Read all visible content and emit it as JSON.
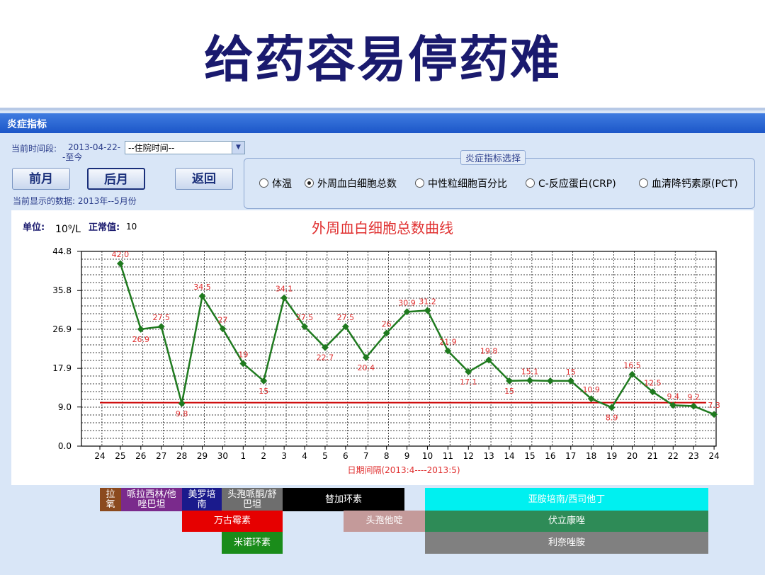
{
  "slide_title": "给药容易停药难",
  "window": {
    "title": "炎症指标",
    "period_label": "当前时间段:",
    "period_value_1": "2013-04-22-",
    "period_value_2": "-至今",
    "select_value": "--住院时间--",
    "buttons": {
      "prev": "前月",
      "next": "后月",
      "back": "返回"
    },
    "current_data_label": "当前显示的数据: 2013年--5月份",
    "indicator_group_title": "炎症指标选择",
    "radios": [
      {
        "label": "体温",
        "selected": false
      },
      {
        "label": "外周血白细胞总数",
        "selected": true
      },
      {
        "label": "中性粒细胞百分比",
        "selected": false
      },
      {
        "label": "C-反应蛋白(CRP)",
        "selected": false
      },
      {
        "label": "血清降钙素原(PCT)",
        "selected": false
      }
    ]
  },
  "chart_header": {
    "unit_label": "单位:",
    "unit_value": "10⁹/L",
    "normal_label": "正常值:",
    "normal_value": "10"
  },
  "chart_data": {
    "type": "line",
    "title": "外周血白细胞总数曲线",
    "xlabel": "日期间隔(2013:4----2013:5)",
    "ylabel": "",
    "x_ticks": [
      "24",
      "25",
      "26",
      "27",
      "28",
      "29",
      "30",
      "1",
      "2",
      "3",
      "4",
      "5",
      "6",
      "7",
      "8",
      "9",
      "10",
      "11",
      "12",
      "13",
      "14",
      "15",
      "16",
      "17",
      "18",
      "19",
      "20",
      "21",
      "22",
      "23",
      "24"
    ],
    "y_ticks": [
      "0.0",
      "9.0",
      "17.9",
      "26.9",
      "35.8",
      "44.8"
    ],
    "ylim": [
      0,
      44.8
    ],
    "reference_line": 10,
    "series": [
      {
        "x": [
          "25",
          "26",
          "27",
          "28",
          "29",
          "30",
          "1",
          "2",
          "3",
          "4",
          "5",
          "6",
          "7",
          "8",
          "9",
          "10",
          "11",
          "12",
          "13",
          "14",
          "15",
          "16",
          "17",
          "18",
          "19",
          "20",
          "21",
          "22",
          "23",
          "24"
        ],
        "values": [
          42.0,
          26.9,
          27.5,
          9.8,
          34.5,
          27,
          19,
          15,
          34.1,
          27.5,
          22.7,
          27.5,
          20.4,
          26,
          30.9,
          31.2,
          21.9,
          17.1,
          19.8,
          15,
          15.1,
          15,
          15,
          10.9,
          8.9,
          16.5,
          12.5,
          9.4,
          9.2,
          7.3
        ],
        "labels": [
          "42.0",
          "26.9",
          "27.5",
          "9.8",
          "34.5",
          "27",
          "19",
          "15",
          "34.1",
          "27.5",
          "22.7",
          "27.5",
          "20.4",
          "26",
          "30.9",
          "31.2",
          "21.9",
          "17.1",
          "19.8",
          "15",
          "15.1",
          "",
          "15",
          "10.9",
          "8.9",
          "16.5",
          "12.5",
          "9.4",
          "9.2",
          "7.3"
        ]
      }
    ],
    "colors": {
      "line": "#1f7a1f",
      "reference": "#cc0000",
      "labels": "#e03030"
    },
    "grid": true
  },
  "drug_legend": [
    {
      "text": "拉\n氧",
      "bg": "#8b4a1e",
      "fg": "#ffffff"
    },
    {
      "text": "哌拉西林/他\n唑巴坦",
      "bg": "#7a2a8c",
      "fg": "#ffffff"
    },
    {
      "text": "美罗培\n南",
      "bg": "#1a1a8c",
      "fg": "#ffffff"
    },
    {
      "text": "头孢哌酮/舒\n巴坦",
      "bg": "#6e6e6e",
      "fg": "#ffffff"
    },
    {
      "text": "替加环素",
      "bg": "#000000",
      "fg": "#ffffff"
    },
    {
      "text": "亚胺培南/西司他丁",
      "bg": "#00f0f0",
      "fg": "#ffffff"
    },
    {
      "text": "万古霉素",
      "bg": "#e60000",
      "fg": "#ffffff"
    },
    {
      "text": "头孢他啶",
      "bg": "#c49a9a",
      "fg": "#ffffff"
    },
    {
      "text": "伏立康唑",
      "bg": "#2e8b57",
      "fg": "#ffffff"
    },
    {
      "text": "米诺环素",
      "bg": "#1a8c1a",
      "fg": "#ffffff"
    },
    {
      "text": "利奈唑胺",
      "bg": "#808080",
      "fg": "#ffffff"
    }
  ]
}
